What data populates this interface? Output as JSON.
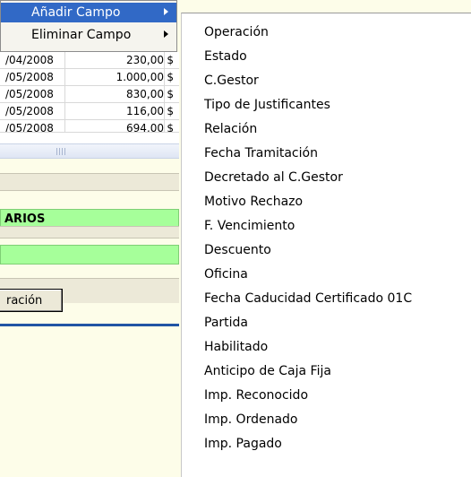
{
  "context_menu": {
    "items": [
      {
        "label": "Añadir Campo",
        "active": true
      },
      {
        "label": "Eliminar Campo",
        "active": false
      }
    ]
  },
  "background_table": {
    "rows": [
      {
        "date": "/04/2008",
        "amount": "230,00",
        "currency": "$"
      },
      {
        "date": "/05/2008",
        "amount": "1.000,00",
        "currency": "$"
      },
      {
        "date": "/05/2008",
        "amount": "830,00",
        "currency": "$"
      },
      {
        "date": "/05/2008",
        "amount": "116,00",
        "currency": "$"
      },
      {
        "date": "/05/2008",
        "amount": "694,00",
        "currency": "$"
      }
    ]
  },
  "background_panel": {
    "section_label": "ARIOS",
    "button_label": "ración"
  },
  "submenu": {
    "items": [
      "Operación",
      "Estado",
      "C.Gestor",
      "Tipo de Justificantes",
      "Relación",
      "Fecha Tramitación",
      "Decretado al C.Gestor",
      "Motivo Rechazo",
      "F. Vencimiento",
      "Descuento",
      "Oficina",
      "Fecha Caducidad Certificado 01C",
      "Partida",
      "Habilitado",
      "Anticipo de Caja Fija",
      "Imp. Reconocido",
      "Imp. Ordenado",
      "Imp. Pagado"
    ]
  },
  "colors": {
    "menu_highlight": "#3169c6",
    "green_band": "#a6ff9a",
    "blue_rule": "#2154a4",
    "background": "#fdfde9"
  }
}
